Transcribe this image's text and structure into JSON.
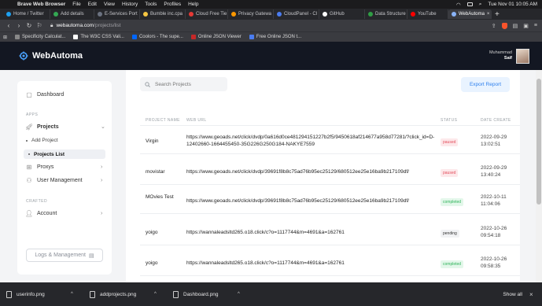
{
  "menubar": {
    "app": "Brave Web Browser",
    "items": [
      "File",
      "Edit",
      "View",
      "History",
      "Tools",
      "Profiles",
      "Help"
    ],
    "datetime": "Tue Nov 01 10:05 AM"
  },
  "tabs": [
    {
      "title": "Home / Twitter",
      "color": "#1da1f2"
    },
    {
      "title": "Add details",
      "color": "#34a853"
    },
    {
      "title": "E-Services Port",
      "color": "#6b7280"
    },
    {
      "title": "Bumble inc.cpa",
      "color": "#f4c542"
    },
    {
      "title": "Cloud Free Tie",
      "color": "#e53935"
    },
    {
      "title": "Privacy Gatewa",
      "color": "#ff9800"
    },
    {
      "title": "CloudPanel - Cl",
      "color": "#4a7cf0"
    },
    {
      "title": "GitHub",
      "color": "#ffffff"
    },
    {
      "title": "Data Structure",
      "color": "#2f9e44"
    },
    {
      "title": "YouTube",
      "color": "#ff0000"
    },
    {
      "title": "WebAutoma",
      "color": "#8ab4f8",
      "active": true
    }
  ],
  "address": {
    "host": "webautoma.com",
    "path": "/projects/list"
  },
  "bookmarks": [
    {
      "label": "Specificity Calculat...",
      "color": "#888888"
    },
    {
      "label": "The W3C CSS Vali...",
      "color": "#ffffff"
    },
    {
      "label": "Coolors - The supe...",
      "color": "#0066ff"
    },
    {
      "label": "Online JSON Viewer",
      "color": "#c62828"
    },
    {
      "label": "Free Online JSON t...",
      "color": "#4a7cf0"
    }
  ],
  "header": {
    "brand": "WebAutoma",
    "user_first": "Muhammad",
    "user_last": "Saif"
  },
  "sidebar": {
    "dashboard": "Dashboard",
    "section_apps": "APPS",
    "projects": "Projects",
    "add_project": "Add Project",
    "projects_list": "Projects List",
    "proxys": "Proxys",
    "user_management": "User Management",
    "section_crafted": "CRAFTED",
    "account": "Account",
    "logs_button": "Logs & Management"
  },
  "main": {
    "search_placeholder": "Search Projects",
    "export_button": "Export Report",
    "columns": {
      "name": "PROJECT NAME",
      "url": "WEB URL",
      "status": "STATUS",
      "date": "DATE CREATE"
    },
    "rows": [
      {
        "name": "Virgin",
        "url": "https://www.geoads.net/click/dvdp/0a616d0ce481294151227b2f5/9450618af214677a958d77281/?click_id=D-12402660-1664455450-35G226G250G184-NAKYE7559",
        "status": "paused",
        "date": "2022-09-29 13:02:51"
      },
      {
        "name": "movistar",
        "url": "https://www.geoads.net/click/dvdp/39691f8b8c75ad76b95ec25129/680512ee25e16ba9b217109df/",
        "status": "paused",
        "date": "2022-09-29 13:40:24"
      },
      {
        "name": "MOvies Test",
        "url": "https://www.geoads.net/click/dvdp/39691f8b8c75ad76b95ec25129/680512ee25e16ba9b217109df/",
        "status": "completed",
        "date": "2022-10-11 11:04:06"
      },
      {
        "name": "yoigo",
        "url": "https://wannaleadsltd265.o18.click/c?o=1117744&m=4691&a=162761",
        "status": "pending",
        "date": "2022-10-26 09:54:18"
      },
      {
        "name": "yoigo",
        "url": "https://wannaleadsltd265.o18.click/c?o=1117744&m=4691&a=162761",
        "status": "completed",
        "date": "2022-10-26 09:58:35"
      }
    ]
  },
  "downloads": {
    "files": [
      "userinfo.png",
      "addprojects.png",
      "Dashboard.png"
    ],
    "show_all": "Show all"
  }
}
